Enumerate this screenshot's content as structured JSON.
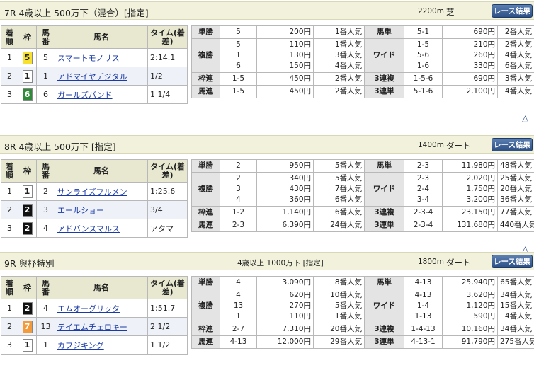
{
  "horse_headers": {
    "chaku": "着順",
    "waku": "枠",
    "umaban": "馬番",
    "name": "馬名",
    "time": "タイム(着差)"
  },
  "pay_labels": {
    "tansho": "単勝",
    "fukusho": "複勝",
    "wakuren": "枠連",
    "umaren": "馬連",
    "umatan": "馬単",
    "wide": "ワイド",
    "sanrenpuku": "3連複",
    "sanrentan": "3連単"
  },
  "result_button": "レース結果",
  "races": [
    {
      "title": "7R 4歳以上 500万下（混合）[指定]",
      "cond": "",
      "distance": "2200m",
      "track": "芝",
      "horses": [
        {
          "chaku": "1",
          "waku": "5",
          "waku_bg": "#f7e02e",
          "waku_fg": "#222222",
          "umaban": "5",
          "name": "スマートモノリス",
          "time": "2:14.1"
        },
        {
          "chaku": "2",
          "waku": "1",
          "waku_bg": "#ffffff",
          "waku_fg": "#222222",
          "umaban": "1",
          "name": "アドマイヤデジタル",
          "time": "1/2"
        },
        {
          "chaku": "3",
          "waku": "6",
          "waku_bg": "#2f8a3a",
          "waku_fg": "#ffffff",
          "umaban": "6",
          "name": "ガールズバンド",
          "time": "1 1/4"
        }
      ],
      "pay": {
        "tansho": [
          {
            "num": "5",
            "yen": "200円",
            "pop": "1番人気"
          }
        ],
        "fukusho": [
          {
            "num": "5",
            "yen": "110円",
            "pop": "1番人気"
          },
          {
            "num": "1",
            "yen": "130円",
            "pop": "3番人気"
          },
          {
            "num": "6",
            "yen": "150円",
            "pop": "4番人気"
          }
        ],
        "wakuren": [
          {
            "num": "1-5",
            "yen": "450円",
            "pop": "2番人気"
          }
        ],
        "umaren": [
          {
            "num": "1-5",
            "yen": "450円",
            "pop": "2番人気"
          }
        ],
        "umatan": [
          {
            "num": "5-1",
            "yen": "690円",
            "pop": "2番人気"
          }
        ],
        "wide": [
          {
            "num": "1-5",
            "yen": "210円",
            "pop": "2番人気"
          },
          {
            "num": "5-6",
            "yen": "260円",
            "pop": "4番人気"
          },
          {
            "num": "1-6",
            "yen": "330円",
            "pop": "6番人気"
          }
        ],
        "sanrenpuku": [
          {
            "num": "1-5-6",
            "yen": "690円",
            "pop": "3番人気"
          }
        ],
        "sanrentan": [
          {
            "num": "5-1-6",
            "yen": "2,100円",
            "pop": "4番人気"
          }
        ]
      }
    },
    {
      "title": "8R 4歳以上 500万下 [指定]",
      "cond": "",
      "distance": "1400m",
      "track": "ダート",
      "horses": [
        {
          "chaku": "1",
          "waku": "1",
          "waku_bg": "#ffffff",
          "waku_fg": "#222222",
          "umaban": "2",
          "name": "サンライズフルメン",
          "time": "1:25.6"
        },
        {
          "chaku": "2",
          "waku": "2",
          "waku_bg": "#111111",
          "waku_fg": "#ffffff",
          "umaban": "3",
          "name": "エールショー",
          "time": "3/4"
        },
        {
          "chaku": "3",
          "waku": "2",
          "waku_bg": "#111111",
          "waku_fg": "#ffffff",
          "umaban": "4",
          "name": "アドバンスマルス",
          "time": "アタマ"
        }
      ],
      "pay": {
        "tansho": [
          {
            "num": "2",
            "yen": "950円",
            "pop": "5番人気"
          }
        ],
        "fukusho": [
          {
            "num": "2",
            "yen": "340円",
            "pop": "5番人気"
          },
          {
            "num": "3",
            "yen": "430円",
            "pop": "7番人気"
          },
          {
            "num": "4",
            "yen": "360円",
            "pop": "6番人気"
          }
        ],
        "wakuren": [
          {
            "num": "1-2",
            "yen": "1,140円",
            "pop": "6番人気"
          }
        ],
        "umaren": [
          {
            "num": "2-3",
            "yen": "6,390円",
            "pop": "24番人気"
          }
        ],
        "umatan": [
          {
            "num": "2-3",
            "yen": "11,980円",
            "pop": "48番人気"
          }
        ],
        "wide": [
          {
            "num": "2-3",
            "yen": "2,020円",
            "pop": "25番人気"
          },
          {
            "num": "2-4",
            "yen": "1,750円",
            "pop": "20番人気"
          },
          {
            "num": "3-4",
            "yen": "3,200円",
            "pop": "36番人気"
          }
        ],
        "sanrenpuku": [
          {
            "num": "2-3-4",
            "yen": "23,150円",
            "pop": "77番人気"
          }
        ],
        "sanrentan": [
          {
            "num": "2-3-4",
            "yen": "131,680円",
            "pop": "440番人気"
          }
        ]
      }
    },
    {
      "title": "9R 與杼特別",
      "cond": "4歳以上 1000万下 [指定]",
      "distance": "1800m",
      "track": "ダート",
      "horses": [
        {
          "chaku": "1",
          "waku": "2",
          "waku_bg": "#111111",
          "waku_fg": "#ffffff",
          "umaban": "4",
          "name": "エムオーグリッタ",
          "time": "1:51.7"
        },
        {
          "chaku": "2",
          "waku": "7",
          "waku_bg": "#f39a3a",
          "waku_fg": "#ffffff",
          "umaban": "13",
          "name": "テイエムチェロキー",
          "time": "2 1/2"
        },
        {
          "chaku": "3",
          "waku": "1",
          "waku_bg": "#ffffff",
          "waku_fg": "#222222",
          "umaban": "1",
          "name": "カフジキング",
          "time": "1 1/2"
        }
      ],
      "pay": {
        "tansho": [
          {
            "num": "4",
            "yen": "3,090円",
            "pop": "8番人気"
          }
        ],
        "fukusho": [
          {
            "num": "4",
            "yen": "620円",
            "pop": "10番人気"
          },
          {
            "num": "13",
            "yen": "270円",
            "pop": "5番人気"
          },
          {
            "num": "1",
            "yen": "110円",
            "pop": "1番人気"
          }
        ],
        "wakuren": [
          {
            "num": "2-7",
            "yen": "7,310円",
            "pop": "20番人気"
          }
        ],
        "umaren": [
          {
            "num": "4-13",
            "yen": "12,000円",
            "pop": "29番人気"
          }
        ],
        "umatan": [
          {
            "num": "4-13",
            "yen": "25,940円",
            "pop": "65番人気"
          }
        ],
        "wide": [
          {
            "num": "4-13",
            "yen": "3,620円",
            "pop": "34番人気"
          },
          {
            "num": "1-4",
            "yen": "1,120円",
            "pop": "15番人気"
          },
          {
            "num": "1-13",
            "yen": "590円",
            "pop": "4番人気"
          }
        ],
        "sanrenpuku": [
          {
            "num": "1-4-13",
            "yen": "10,160円",
            "pop": "34番人気"
          }
        ],
        "sanrentan": [
          {
            "num": "4-13-1",
            "yen": "91,790円",
            "pop": "275番人気"
          }
        ]
      }
    }
  ],
  "top_link": "△"
}
